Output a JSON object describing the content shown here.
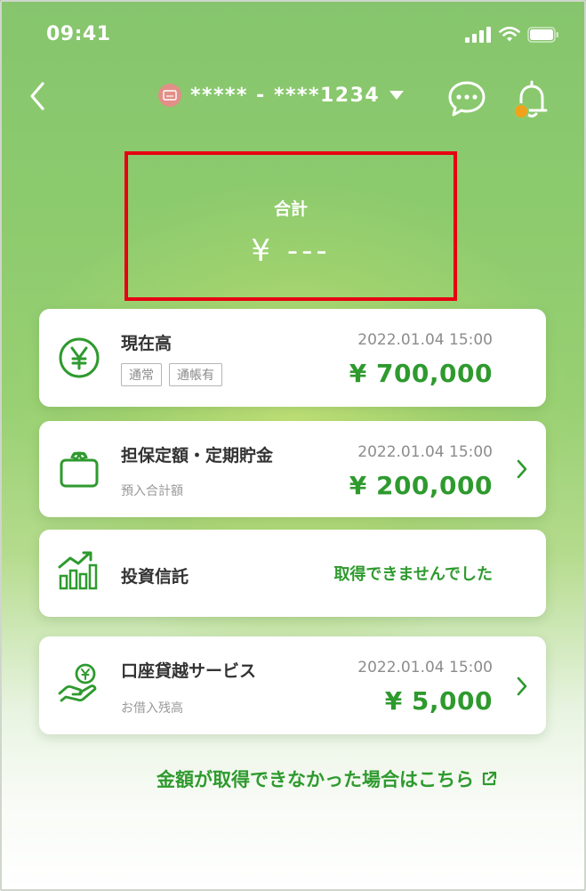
{
  "status_bar": {
    "time": "09:41"
  },
  "header": {
    "account_label": "***** - ****1234"
  },
  "total": {
    "label": "合計",
    "value": "¥ ---"
  },
  "cards": [
    {
      "title": "現在高",
      "tags": [
        "通常",
        "通帳有"
      ],
      "date": "2022.01.04 15:00",
      "value": "¥ 700,000"
    },
    {
      "title": "担保定額・定期貯金",
      "subtitle": "預入合計額",
      "date": "2022.01.04 15:00",
      "value": "¥ 200,000"
    },
    {
      "title": "投資信託",
      "status": "取得できませんでした"
    },
    {
      "title": "口座貸越サービス",
      "subtitle": "お借入残高",
      "date": "2022.01.04 15:00",
      "value": "¥ 5,000"
    }
  ],
  "footer": {
    "link_label": "金額が取得できなかった場合はこちら"
  },
  "colors": {
    "accent": "#2e9a2e",
    "highlight_border": "#e60012",
    "background_green": "#8dcb6e",
    "notification_dot": "#f0a21a"
  }
}
